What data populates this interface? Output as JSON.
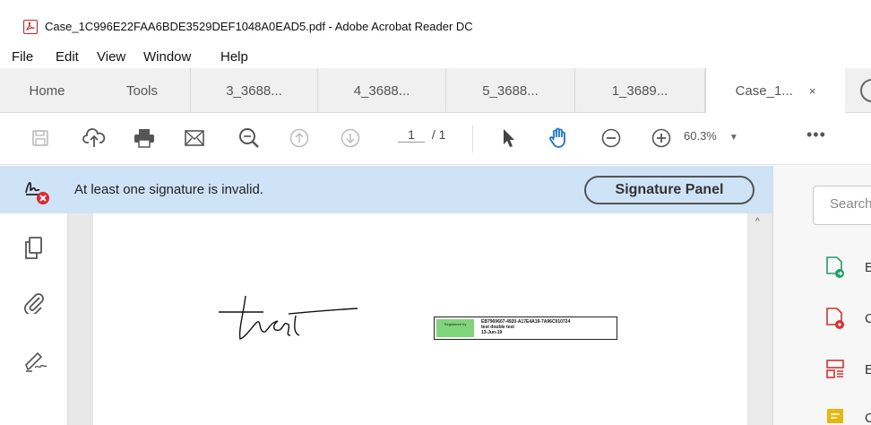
{
  "window": {
    "title": "Case_1C996E22FAA6BDE3529DEF1048A0EAD5.pdf - Adobe Acrobat Reader DC",
    "app_icon": "acrobat-pdf-icon"
  },
  "menu": [
    "File",
    "Edit",
    "View",
    "Window",
    "Help"
  ],
  "tabs": {
    "home": "Home",
    "tools": "Tools",
    "docs": [
      "3_3688...",
      "4_3688...",
      "5_3688...",
      "1_3689..."
    ],
    "active": "Case_1...",
    "close": "×"
  },
  "toolbar": {
    "page_current": "1",
    "page_total": "/ 1",
    "zoom": "60.3%",
    "zoom_caret": "▼",
    "more": "•••",
    "icons": [
      "save-icon",
      "upload-cloud-icon",
      "print-icon",
      "email-icon",
      "zoom-search-icon",
      "prev-page-icon",
      "next-page-icon",
      "select-cursor-icon",
      "hand-tool-icon",
      "zoom-out-icon",
      "zoom-in-icon"
    ]
  },
  "banner": {
    "message": "At least one signature is invalid.",
    "button": "Signature Panel"
  },
  "document": {
    "handwriting": "test",
    "signature_box": {
      "badge": "Registered by",
      "line1": "EB7969607-4920-A17E4A19-7A96C910724",
      "line2": "test double test",
      "line3": "13-Jun-19"
    }
  },
  "right_pane": {
    "search_placeholder": "Search",
    "tools": [
      {
        "label": "E",
        "icon": "export-pdf-icon",
        "color": "#1e9e6b"
      },
      {
        "label": "C",
        "icon": "create-pdf-icon",
        "color": "#d4322f"
      },
      {
        "label": "E",
        "icon": "edit-pdf-icon",
        "color": "#d4322f"
      },
      {
        "label": "C",
        "icon": "comment-icon",
        "color": "#e8b70d"
      }
    ]
  },
  "colors": {
    "banner": "#cfe3f7",
    "accent_red": "#d3231e"
  }
}
